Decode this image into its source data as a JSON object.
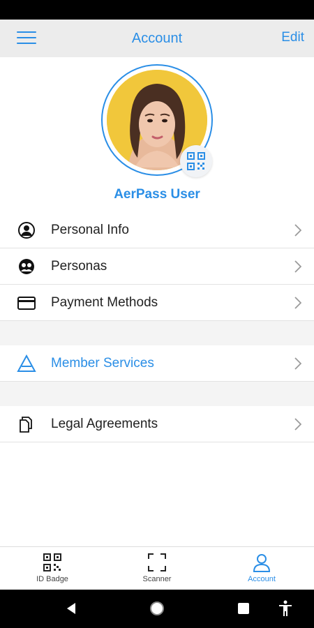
{
  "header": {
    "title": "Account",
    "edit_label": "Edit"
  },
  "profile": {
    "username": "AerPass User"
  },
  "menu": {
    "personal_info": "Personal Info",
    "personas": "Personas",
    "payment_methods": "Payment Methods",
    "member_services": "Member Services",
    "legal_agreements": "Legal Agreements"
  },
  "tabs": {
    "id_badge": "ID Badge",
    "scanner": "Scanner",
    "account": "Account"
  },
  "colors": {
    "accent": "#2a8ee6"
  }
}
